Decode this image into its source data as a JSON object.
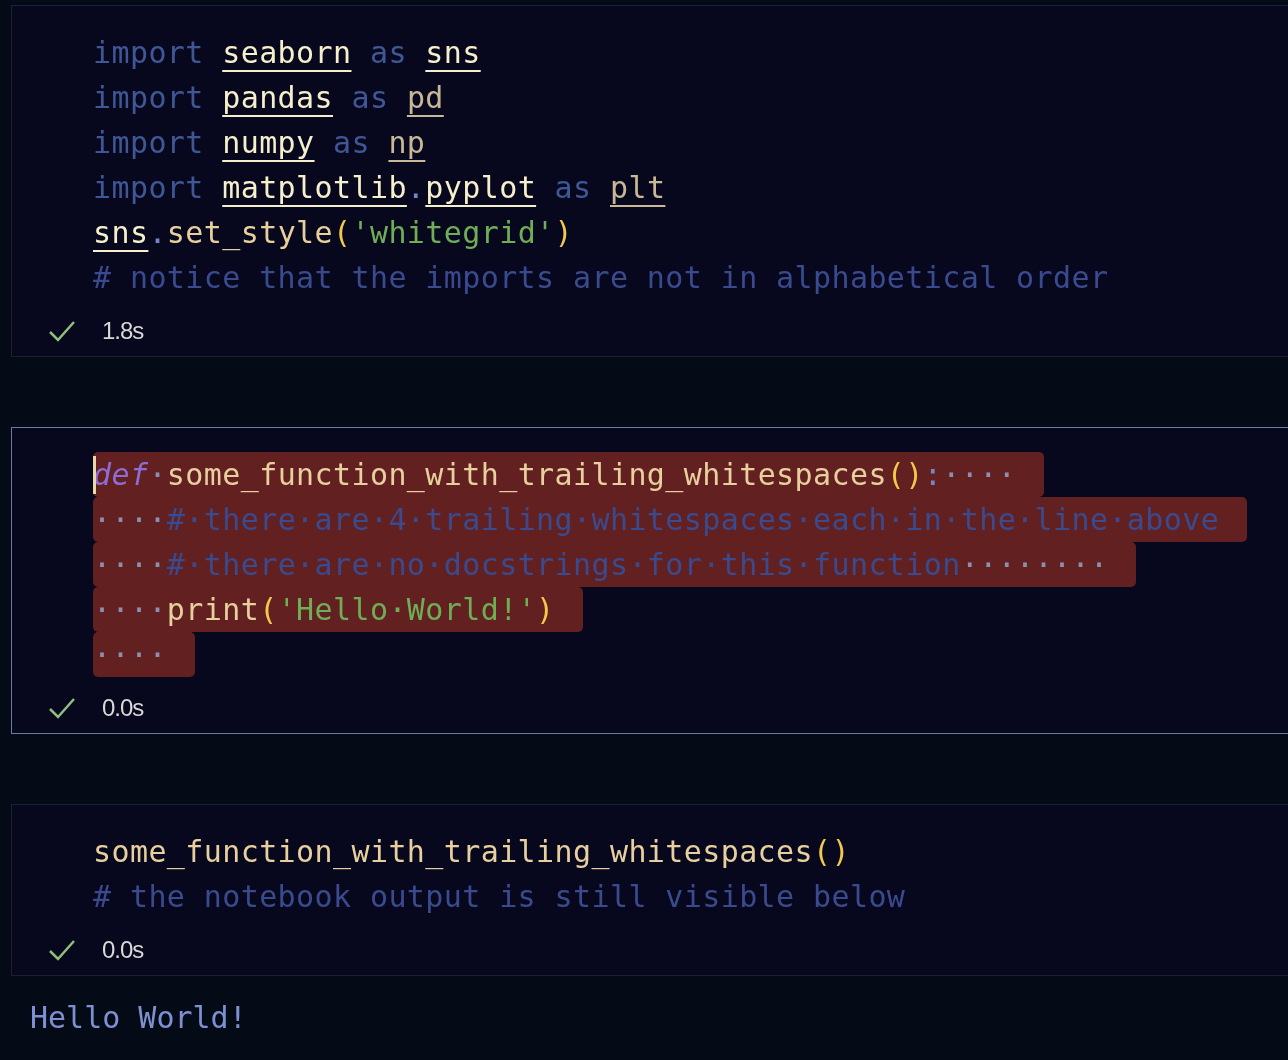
{
  "cells": [
    {
      "focused": false,
      "status": "1.8s",
      "lines": [
        {
          "flagged": false,
          "tokens": [
            {
              "text": "import ",
              "kind": "keyword"
            },
            {
              "text": "seaborn",
              "kind": "module"
            },
            {
              "text": " as ",
              "kind": "keyword"
            },
            {
              "text": "sns",
              "kind": "module"
            }
          ]
        },
        {
          "flagged": false,
          "tokens": [
            {
              "text": "import ",
              "kind": "keyword"
            },
            {
              "text": "pandas",
              "kind": "module"
            },
            {
              "text": " as ",
              "kind": "keyword"
            },
            {
              "text": "pd",
              "kind": "alias"
            }
          ]
        },
        {
          "flagged": false,
          "tokens": [
            {
              "text": "import ",
              "kind": "keyword"
            },
            {
              "text": "numpy",
              "kind": "module"
            },
            {
              "text": " as ",
              "kind": "keyword"
            },
            {
              "text": "np",
              "kind": "alias"
            }
          ]
        },
        {
          "flagged": false,
          "tokens": [
            {
              "text": "import ",
              "kind": "keyword"
            },
            {
              "text": "matplotlib",
              "kind": "module"
            },
            {
              "text": ".",
              "kind": "punct"
            },
            {
              "text": "pyplot",
              "kind": "module"
            },
            {
              "text": " as ",
              "kind": "keyword"
            },
            {
              "text": "plt",
              "kind": "alias"
            }
          ]
        },
        {
          "flagged": false,
          "tokens": [
            {
              "text": "sns",
              "kind": "module"
            },
            {
              "text": ".",
              "kind": "punct"
            },
            {
              "text": "set_style",
              "kind": "func"
            },
            {
              "text": "(",
              "kind": "paren"
            },
            {
              "text": "'whitegrid'",
              "kind": "string"
            },
            {
              "text": ")",
              "kind": "paren"
            }
          ]
        },
        {
          "flagged": false,
          "tokens": [
            {
              "text": "# notice that the imports are not in alphabetical order",
              "kind": "comment"
            }
          ]
        }
      ]
    },
    {
      "focused": true,
      "status": "0.0s",
      "lines": [
        {
          "flagged": true,
          "tokens": [
            {
              "text": "def",
              "kind": "def"
            },
            {
              "text": "·",
              "kind": "space"
            },
            {
              "text": "some_function_with_trailing_whitespaces",
              "kind": "func"
            },
            {
              "text": "()",
              "kind": "paren"
            },
            {
              "text": ":",
              "kind": "punct"
            },
            {
              "text": "····",
              "kind": "space"
            }
          ]
        },
        {
          "flagged": true,
          "tokens": [
            {
              "text": "····",
              "kind": "space"
            },
            {
              "text": "#·there·are·4·trailing·whitespaces·each·in·the·line·above",
              "kind": "comment"
            }
          ]
        },
        {
          "flagged": true,
          "tokens": [
            {
              "text": "····",
              "kind": "space"
            },
            {
              "text": "#·there·are·no·docstrings·for·this·function",
              "kind": "comment"
            },
            {
              "text": "········",
              "kind": "space"
            }
          ]
        },
        {
          "flagged": true,
          "tokens": [
            {
              "text": "····",
              "kind": "space"
            },
            {
              "text": "print",
              "kind": "func"
            },
            {
              "text": "(",
              "kind": "paren"
            },
            {
              "text": "'Hello·World!'",
              "kind": "string"
            },
            {
              "text": ")",
              "kind": "paren"
            }
          ]
        },
        {
          "flagged": true,
          "tokens": [
            {
              "text": "····",
              "kind": "space"
            }
          ]
        }
      ]
    },
    {
      "focused": false,
      "status": "0.0s",
      "lines": [
        {
          "flagged": false,
          "tokens": [
            {
              "text": "some_function_with_trailing_whitespaces",
              "kind": "func"
            },
            {
              "text": "()",
              "kind": "paren"
            }
          ]
        },
        {
          "flagged": false,
          "tokens": [
            {
              "text": "# the notebook output is still visible below",
              "kind": "comment"
            }
          ]
        }
      ],
      "output": "Hello World!"
    }
  ]
}
